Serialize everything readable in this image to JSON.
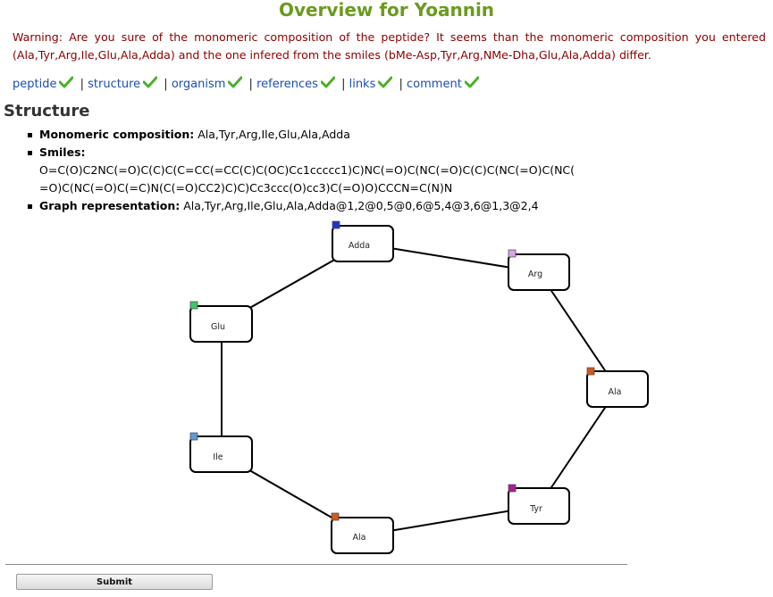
{
  "page": {
    "title": "Overview for Yoannin"
  },
  "warning": {
    "text": "Warning: Are you sure of the monomeric composition of the peptide? It seems than the monomeric composition you entered (Ala,Tyr,Arg,Ile,Glu,Ala,Adda) and the one infered from the smiles (bMe-Asp,Tyr,Arg,NMe-Dha,Glu,Ala,Adda) differ."
  },
  "nav": {
    "items": [
      {
        "label": "peptide",
        "icon": "check-icon"
      },
      {
        "label": "structure",
        "icon": "check-icon"
      },
      {
        "label": "organism",
        "icon": "check-icon"
      },
      {
        "label": "references",
        "icon": "check-icon"
      },
      {
        "label": "links",
        "icon": "check-icon"
      },
      {
        "label": "comment",
        "icon": "check-icon"
      }
    ],
    "separator": "|",
    "check_color": "#4caf2a"
  },
  "structure": {
    "heading": "Structure",
    "monomeric_label": "Monomeric composition:",
    "monomeric_value": "Ala,Tyr,Arg,Ile,Glu,Ala,Adda",
    "smiles_label": "Smiles:",
    "smiles_line1": "O=C(O)C2NC(=O)C(C)C(C=CC(=CC(C)C(OC)Cc1ccccc1)C)NC(=O)C(NC(=O)C(C)C(NC(=O)C(NC(",
    "smiles_line2": "=O)C(NC(=O)C(=C)N(C(=O)CC2)C)C)Cc3ccc(O)cc3)C(=O)O)CCCN=C(N)N",
    "graph_label": "Graph representation:",
    "graph_value": "Ala,Tyr,Arg,Ile,Glu,Ala,Adda@1,2@0,5@0,6@5,4@3,6@1,3@2,4"
  },
  "graph": {
    "nodes": [
      {
        "label": "Adda",
        "color": "#2233cc"
      },
      {
        "label": "Arg",
        "color": "#d9a3e6"
      },
      {
        "label": "Glu",
        "color": "#3cc96a"
      },
      {
        "label": "Ala",
        "color": "#d2591c"
      },
      {
        "label": "Ile",
        "color": "#5b9bd5"
      },
      {
        "label": "Tyr",
        "color": "#a8238f"
      },
      {
        "label": "Ala",
        "color": "#d2591c"
      }
    ]
  },
  "form": {
    "submit_label": "Submit"
  }
}
